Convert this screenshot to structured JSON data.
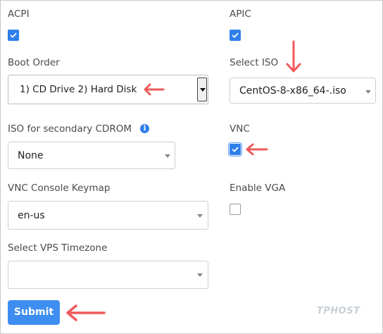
{
  "fields": {
    "acpi": {
      "label": "ACPI",
      "checked": true
    },
    "apic": {
      "label": "APIC",
      "checked": true
    },
    "boot_order": {
      "label": "Boot Order",
      "value": "1) CD Drive 2) Hard Disk"
    },
    "select_iso": {
      "label": "Select ISO",
      "value": "CentOS-8-x86_64-.iso"
    },
    "iso_secondary": {
      "label": "ISO for secondary CDROM",
      "value": "None",
      "info_icon": "info-icon"
    },
    "vnc": {
      "label": "VNC",
      "checked": true
    },
    "vnc_keymap": {
      "label": "VNC Console Keymap",
      "value": "en-us"
    },
    "enable_vga": {
      "label": "Enable VGA",
      "checked": false
    },
    "vps_timezone": {
      "label": "Select VPS Timezone",
      "value": ""
    }
  },
  "submit": {
    "label": "Submit"
  },
  "watermark": "TPHOST",
  "colors": {
    "accent": "#2f7fea",
    "arrow": "#f05a5a",
    "button": "#3d8ef0"
  }
}
